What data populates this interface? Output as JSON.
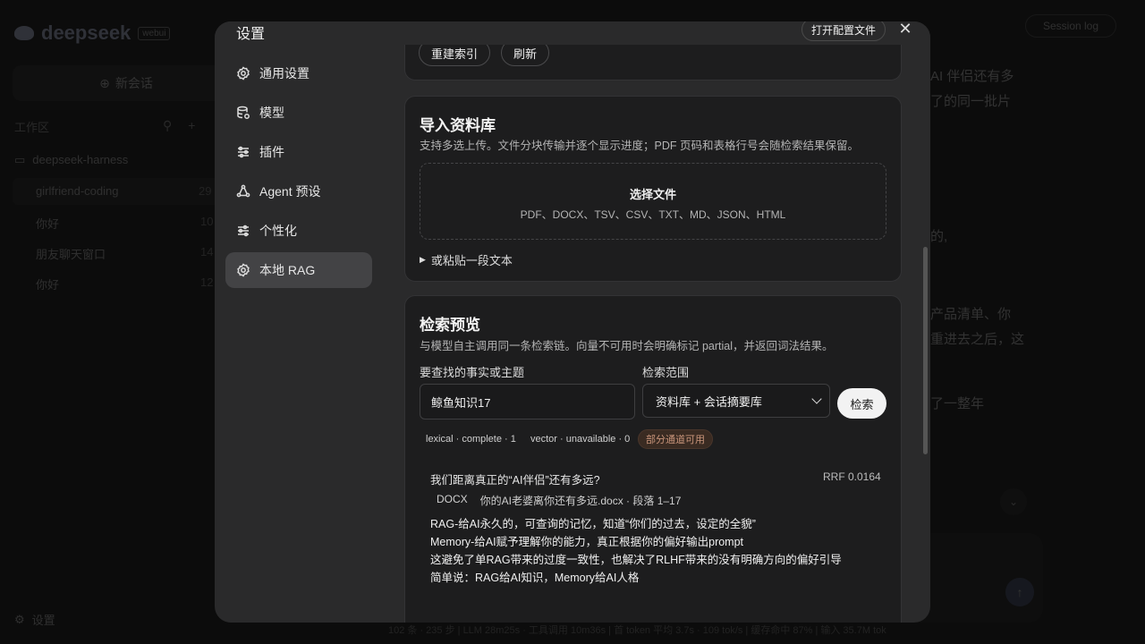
{
  "background": {
    "logo": "deepseek",
    "logo_version": "webui",
    "new_chat": "新会话",
    "workspace_label": "工作区",
    "folder": "deepseek-harness",
    "chats": [
      {
        "title": "girlfriend-coding",
        "count": "29"
      },
      {
        "title": "你好",
        "count": "10"
      },
      {
        "title": "朋友聊天窗口",
        "count": "14"
      },
      {
        "title": "你好",
        "count": "12"
      }
    ],
    "settings_label": "设置",
    "session_log": "Session log",
    "text_lines": [
      "AI 伴侣还有多",
      "了的同一批片",
      "的,",
      "产品清单、你",
      "重进去之后，这",
      "了一整年"
    ],
    "status_bar": "102 条 · 235 步  |  LLM 28m25s · 工具调用 10m36s  |  首 token 平均 3.7s · 109 tok/s  |  缓存命中 87%  |  输入 35.7M tok"
  },
  "modal": {
    "title": "设置",
    "open_config": "打开配置文件",
    "close": "✕",
    "nav": [
      {
        "label": "通用设置",
        "icon": "gear-icon"
      },
      {
        "label": "模型",
        "icon": "database-icon"
      },
      {
        "label": "插件",
        "icon": "sliders-icon"
      },
      {
        "label": "Agent 预设",
        "icon": "agent-icon"
      },
      {
        "label": "个性化",
        "icon": "sliders-icon"
      },
      {
        "label": "本地 RAG",
        "icon": "gear-icon"
      }
    ],
    "index_card": {
      "rebuild": "重建索引",
      "refresh": "刷新"
    },
    "import": {
      "title": "导入资料库",
      "desc": "支持多选上传。文件分块传输并逐个显示进度；PDF 页码和表格行号会随检索结果保留。",
      "choose_file": "选择文件",
      "file_types": "PDF、DOCX、TSV、CSV、TXT、MD、JSON、HTML",
      "paste_text": "或粘贴一段文本"
    },
    "search": {
      "title": "检索预览",
      "desc": "与模型自主调用同一条检索链。向量不可用时会明确标记 partial，并返回词法结果。",
      "query_label": "要查找的事实或主题",
      "query_value": "鲸鱼知识17",
      "scope_label": "检索范围",
      "scope_value": "资料库 + 会话摘要库",
      "search_btn": "检索",
      "chips": [
        "lexical · complete · 1",
        "vector · unavailable · 0",
        "部分通道可用"
      ],
      "result": {
        "title": "我们距离真正的“AI伴侣”还有多远?",
        "score": "RRF 0.0164",
        "src_type": "DOCX",
        "src_file": "你的AI老婆离你还有多远.docx · 段落 1–17",
        "lines": [
          "RAG-给AI永久的，可查询的记忆，知道“你们的过去，设定的全貌”",
          "Memory-给AI赋予理解你的能力，真正根据你的偏好输出prompt",
          "这避免了单RAG带来的过度一致性，也解决了RLHF带来的没有明确方向的偏好引导",
          "简单说：RAG给AI知识，Memory给AI人格"
        ]
      }
    }
  }
}
